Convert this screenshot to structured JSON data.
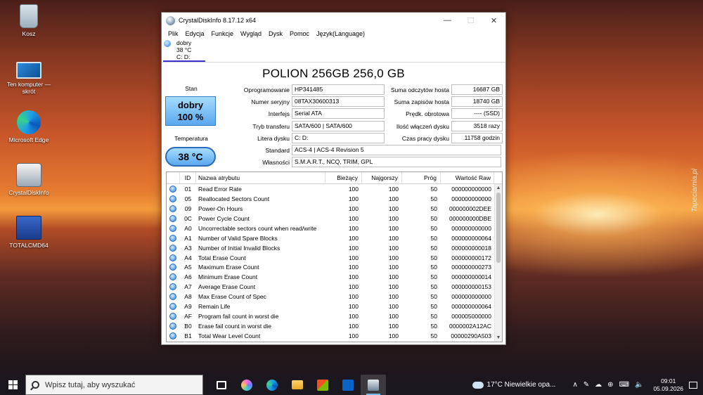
{
  "desktop": {
    "icons": [
      {
        "label": "Kosz",
        "icon": "recycle-bin-icon"
      },
      {
        "label": "Ten komputer — skrót",
        "icon": "this-pc-icon"
      },
      {
        "label": "Microsoft Edge",
        "icon": "edge-icon"
      },
      {
        "label": "CrystalDiskInfo",
        "icon": "crystaldiskinfo-icon"
      },
      {
        "label": "TOTALCMD64",
        "icon": "totalcmd-icon"
      }
    ],
    "watermark": "Tapeciarnia.pl"
  },
  "window": {
    "title": "CrystalDiskInfo 8.17.12 x64",
    "controls": {
      "minimize": "—",
      "maximize": "☐",
      "close": "✕"
    },
    "menu": [
      "Plik",
      "Edycja",
      "Funkcje",
      "Wygląd",
      "Dysk",
      "Pomoc",
      "Język(Language)"
    ],
    "disk_tab": {
      "status": "dobry",
      "temp": "38 °C",
      "drive": "C: D:"
    },
    "model": "POLION 256GB 256,0 GB",
    "health": {
      "label": "Stan",
      "status": "dobry",
      "percent": "100 %"
    },
    "temperature": {
      "label": "Temperatura",
      "value": "38 °C"
    },
    "info": {
      "firmware": {
        "label": "Oprogramowanie",
        "value": "HP341485"
      },
      "serial": {
        "label": "Numer seryjny",
        "value": "08TAX30600313"
      },
      "interface": {
        "label": "Interfejs",
        "value": "Serial ATA"
      },
      "transfer": {
        "label": "Tryb transferu",
        "value": "SATA/600 | SATA/600"
      },
      "drive_letter": {
        "label": "Litera dysku",
        "value": "C: D:"
      },
      "standard": {
        "label": "Standard",
        "value": "ACS-4 | ACS-4 Revision 5"
      },
      "features": {
        "label": "Własności",
        "value": "S.M.A.R.T., NCQ, TRIM, GPL"
      },
      "host_reads": {
        "label": "Suma odczytów hosta",
        "value": "16687 GB"
      },
      "host_writes": {
        "label": "Suma zapisów hosta",
        "value": "18740 GB"
      },
      "rotation": {
        "label": "Prędk. obrotowa",
        "value": "---- (SSD)"
      },
      "power_on_count": {
        "label": "Ilość włączeń dysku",
        "value": "3518 razy"
      },
      "power_on_hours": {
        "label": "Czas pracy dysku",
        "value": "11758 godzin"
      }
    },
    "smart": {
      "headers": {
        "id": "ID",
        "name": "Nazwa atrybutu",
        "current": "Bieżący",
        "worst": "Najgorszy",
        "threshold": "Próg",
        "raw": "Wartość Raw"
      },
      "rows": [
        {
          "id": "01",
          "name": "Read Error Rate",
          "current": "100",
          "worst": "100",
          "threshold": "50",
          "raw": "000000000000"
        },
        {
          "id": "05",
          "name": "Reallocated Sectors Count",
          "current": "100",
          "worst": "100",
          "threshold": "50",
          "raw": "000000000000"
        },
        {
          "id": "09",
          "name": "Power-On Hours",
          "current": "100",
          "worst": "100",
          "threshold": "50",
          "raw": "000000002DEE"
        },
        {
          "id": "0C",
          "name": "Power Cycle Count",
          "current": "100",
          "worst": "100",
          "threshold": "50",
          "raw": "000000000DBE"
        },
        {
          "id": "A0",
          "name": "Uncorrectable sectors count when read/write",
          "current": "100",
          "worst": "100",
          "threshold": "50",
          "raw": "000000000000"
        },
        {
          "id": "A1",
          "name": "Number of Valid Spare Blocks",
          "current": "100",
          "worst": "100",
          "threshold": "50",
          "raw": "000000000064"
        },
        {
          "id": "A3",
          "name": "Number of Initial Invalid Blocks",
          "current": "100",
          "worst": "100",
          "threshold": "50",
          "raw": "000000000018"
        },
        {
          "id": "A4",
          "name": "Total Erase Count",
          "current": "100",
          "worst": "100",
          "threshold": "50",
          "raw": "000000000172"
        },
        {
          "id": "A5",
          "name": "Maximum Erase Count",
          "current": "100",
          "worst": "100",
          "threshold": "50",
          "raw": "000000000273"
        },
        {
          "id": "A6",
          "name": "Minimum Erase Count",
          "current": "100",
          "worst": "100",
          "threshold": "50",
          "raw": "000000000014"
        },
        {
          "id": "A7",
          "name": "Average Erase Count",
          "current": "100",
          "worst": "100",
          "threshold": "50",
          "raw": "000000000153"
        },
        {
          "id": "A8",
          "name": "Max Erase Count of Spec",
          "current": "100",
          "worst": "100",
          "threshold": "50",
          "raw": "000000000000"
        },
        {
          "id": "A9",
          "name": "Remain Life",
          "current": "100",
          "worst": "100",
          "threshold": "50",
          "raw": "000000000064"
        },
        {
          "id": "AF",
          "name": "Program fail count in worst die",
          "current": "100",
          "worst": "100",
          "threshold": "50",
          "raw": "000005000000"
        },
        {
          "id": "B0",
          "name": "Erase fail count in worst die",
          "current": "100",
          "worst": "100",
          "threshold": "50",
          "raw": "0000002A12AC"
        },
        {
          "id": "B1",
          "name": "Total Wear Level Count",
          "current": "100",
          "worst": "100",
          "threshold": "50",
          "raw": "00000290A503"
        }
      ]
    }
  },
  "taskbar": {
    "search_placeholder": "Wpisz tutaj, aby wyszukać",
    "apps": [
      "task-view-icon",
      "copilot-icon",
      "edge-icon",
      "file-explorer-icon",
      "store-icon",
      "outlook-icon",
      "crystaldiskinfo-icon"
    ],
    "weather": "17°C  Niewielkie opa...",
    "tray_symbols": {
      "up": "∧",
      "pen": "✎",
      "cloud": "☁",
      "volume": "🔈",
      "lang": "⊕",
      "keyboard": "⌨",
      "battery": "▭"
    },
    "time": "09:01",
    "date": "05.09.2026"
  }
}
